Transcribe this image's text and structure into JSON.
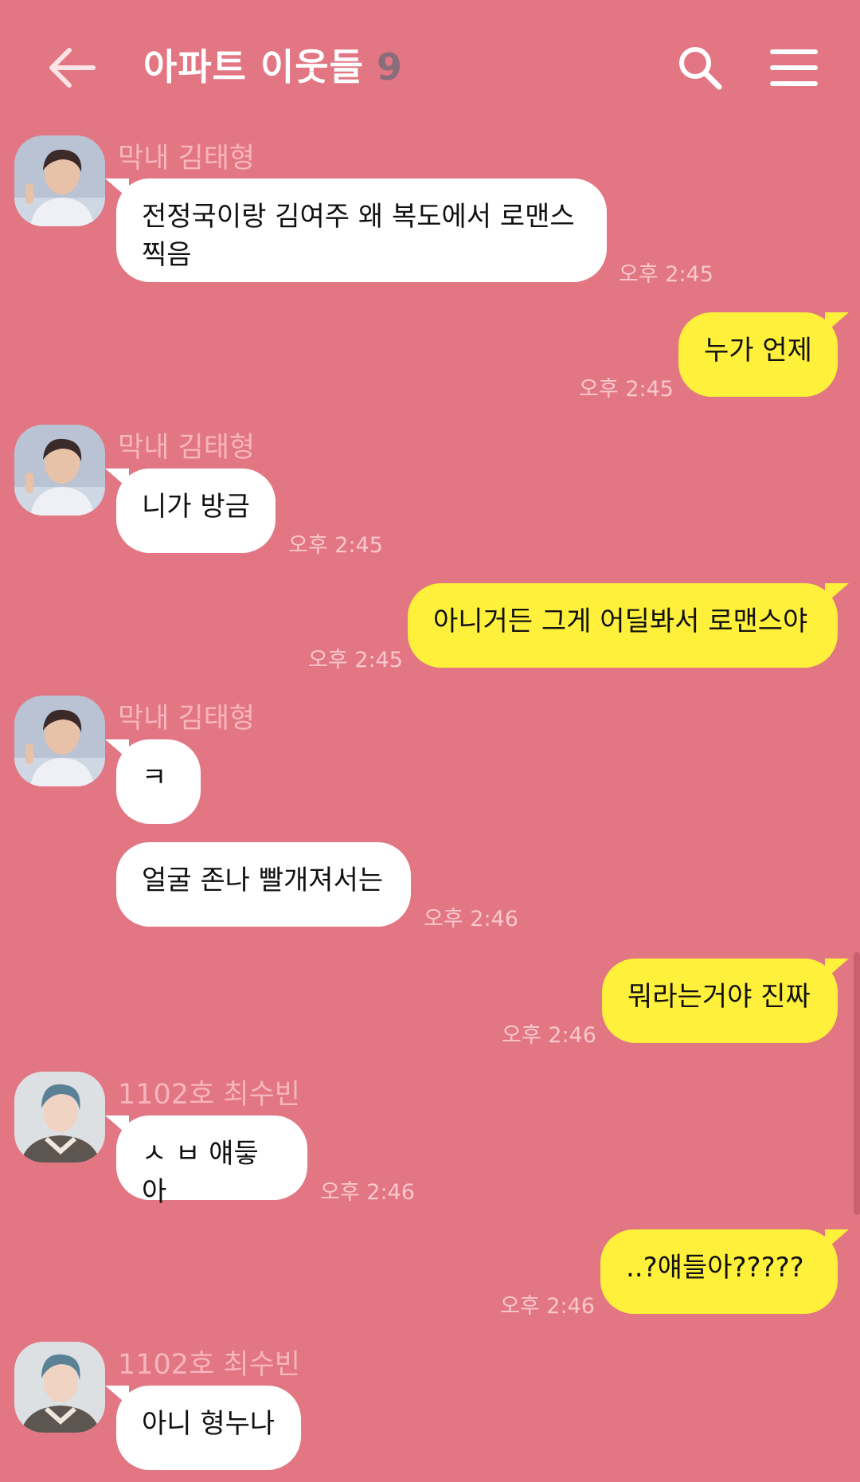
{
  "header": {
    "title": "아파트 이웃들",
    "member_count": "9",
    "back_icon": "arrow-left-icon",
    "search_icon": "search-icon",
    "menu_icon": "hamburger-menu-icon"
  },
  "colors": {
    "background": "#e27683",
    "incoming_bubble": "#ffffff",
    "outgoing_bubble": "#fff03c",
    "sender_name": "#f7b5bd",
    "timestamp": "#f8c8cd"
  },
  "messages": [
    {
      "direction": "in",
      "sender": "막내 김태형",
      "lines": [
        "전정국이랑 김여주 왜 복도에서 로맨스",
        "찍음"
      ],
      "time": "오후 2:45"
    },
    {
      "direction": "out",
      "text": "누가 언제",
      "time": "오후 2:45"
    },
    {
      "direction": "in",
      "sender": "막내 김태형",
      "text": "니가 방금",
      "time": "오후 2:45"
    },
    {
      "direction": "out",
      "text": "아니거든 그게 어딜봐서 로맨스야",
      "time": "오후 2:45"
    },
    {
      "direction": "in",
      "sender": "막내 김태형",
      "text": "ㅋ"
    },
    {
      "direction": "in",
      "text": "얼굴 존나 빨개져서는",
      "time": "오후 2:46"
    },
    {
      "direction": "out",
      "text": "뭐라는거야 진짜",
      "time": "오후 2:46"
    },
    {
      "direction": "in",
      "sender": "1102호 최수빈",
      "text": "ㅅ ㅂ 얘듷아",
      "time": "오후 2:46"
    },
    {
      "direction": "out",
      "text": "..?얘들아?????",
      "time": "오후 2:46"
    },
    {
      "direction": "in",
      "sender": "1102호 최수빈",
      "text": "아니 형누나"
    }
  ]
}
